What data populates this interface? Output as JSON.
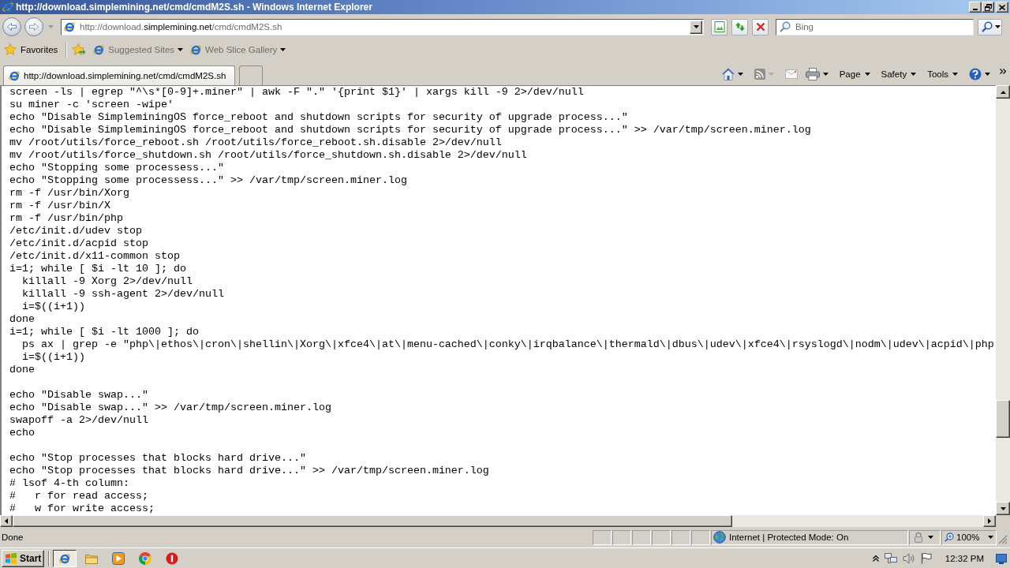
{
  "window": {
    "title": "http://download.simplemining.net/cmd/cmdM2S.sh - Windows Internet Explorer"
  },
  "address_bar": {
    "url_parts": [
      {
        "text": "http://download.",
        "emphasis": false
      },
      {
        "text": "simplemining.net",
        "emphasis": true
      },
      {
        "text": "/cmd/cmdM2S.sh",
        "emphasis": false
      }
    ]
  },
  "search": {
    "placeholder": "Bing"
  },
  "favorites_bar": {
    "favorites_label": "Favorites",
    "items": [
      {
        "label": "Suggested Sites"
      },
      {
        "label": "Web Slice Gallery"
      }
    ]
  },
  "tabs": [
    {
      "label": "http://download.simplemining.net/cmd/cmdM2S.sh",
      "selected": true
    }
  ],
  "command_bar": {
    "menus": [
      {
        "label": "Page"
      },
      {
        "label": "Safety"
      },
      {
        "label": "Tools"
      }
    ]
  },
  "document": {
    "blocks": [
      [
        "screen -ls | egrep \"^\\s*[0-9]+.miner\" | awk -F \".\" '{print $1}' | xargs kill -9 2>/dev/null",
        "su miner -c 'screen -wipe'",
        "echo \"Disable SimpleminingOS force_reboot and shutdown scripts for security of upgrade process...\"",
        "echo \"Disable SimpleminingOS force_reboot and shutdown scripts for security of upgrade process...\" >> /var/tmp/screen.miner.log",
        "mv /root/utils/force_reboot.sh /root/utils/force_reboot.sh.disable 2>/dev/null",
        "mv /root/utils/force_shutdown.sh /root/utils/force_shutdown.sh.disable 2>/dev/null",
        "echo \"Stopping some processess...\"",
        "echo \"Stopping some processess...\" >> /var/tmp/screen.miner.log",
        "rm -f /usr/bin/Xorg",
        "rm -f /usr/bin/X",
        "rm -f /usr/bin/php",
        "/etc/init.d/udev stop",
        "/etc/init.d/acpid stop",
        "/etc/init.d/x11-common stop",
        "i=1; while [ $i -lt 10 ]; do",
        "  killall -9 Xorg 2>/dev/null",
        "  killall -9 ssh-agent 2>/dev/null",
        "  i=$((i+1))",
        "done",
        "i=1; while [ $i -lt 1000 ]; do",
        "  ps ax | grep -e \"php\\|ethos\\|cron\\|shellin\\|Xorg\\|xfce4\\|at\\|menu-cached\\|conky\\|irqbalance\\|thermald\\|dbus\\|udev\\|xfce4\\|rsyslogd\\|nodm\\|udev\\|acpid\\|php",
        "  i=$((i+1))",
        "done"
      ],
      [
        "echo \"Disable swap...\"",
        "echo \"Disable swap...\" >> /var/tmp/screen.miner.log",
        "swapoff -a 2>/dev/null",
        "echo"
      ],
      [
        "echo \"Stop processes that blocks hard drive...\"",
        "echo \"Stop processes that blocks hard drive...\" >> /var/tmp/screen.miner.log",
        "# lsof 4-th column:",
        "#   r for read access;",
        "#   w for write access;"
      ]
    ]
  },
  "status_bar": {
    "text": "Done",
    "zone": "Internet | Protected Mode: On",
    "zoom": "100%"
  },
  "taskbar": {
    "start_label": "Start",
    "apps": [
      {
        "kind": "browser",
        "selected": true
      },
      {
        "kind": "folder",
        "selected": false
      },
      {
        "kind": "media",
        "selected": false
      },
      {
        "kind": "chrome",
        "selected": false
      },
      {
        "kind": "stop",
        "selected": false
      }
    ],
    "clock": "12:32 PM"
  }
}
